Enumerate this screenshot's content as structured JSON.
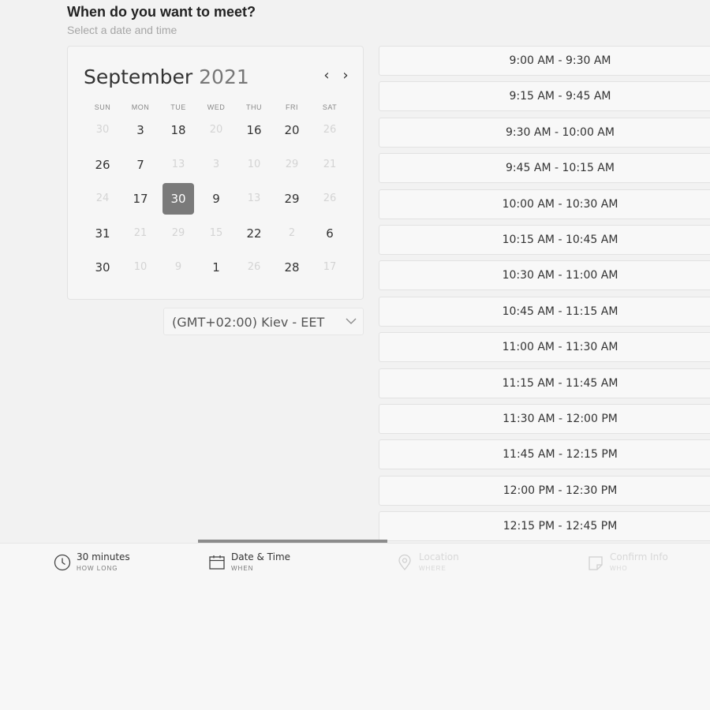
{
  "header": {
    "title": "When do you want to meet?",
    "subtitle": "Select a date and time"
  },
  "calendar": {
    "month": "September",
    "year": "2021",
    "prev_icon": "chevron-left-icon",
    "next_icon": "chevron-right-icon",
    "weekdays": [
      "SUN",
      "MON",
      "TUE",
      "WED",
      "THU",
      "FRI",
      "SAT"
    ],
    "weeks": [
      [
        {
          "d": "30",
          "on": false
        },
        {
          "d": "3",
          "on": true
        },
        {
          "d": "18",
          "on": true
        },
        {
          "d": "20",
          "on": false
        },
        {
          "d": "16",
          "on": true
        },
        {
          "d": "20",
          "on": true
        },
        {
          "d": "26",
          "on": false
        }
      ],
      [
        {
          "d": "26",
          "on": true
        },
        {
          "d": "7",
          "on": true
        },
        {
          "d": "13",
          "on": false
        },
        {
          "d": "3",
          "on": false
        },
        {
          "d": "10",
          "on": false
        },
        {
          "d": "29",
          "on": false
        },
        {
          "d": "21",
          "on": false
        }
      ],
      [
        {
          "d": "24",
          "on": false
        },
        {
          "d": "17",
          "on": true
        },
        {
          "d": "30",
          "on": true,
          "selected": true
        },
        {
          "d": "9",
          "on": true
        },
        {
          "d": "13",
          "on": false
        },
        {
          "d": "29",
          "on": true
        },
        {
          "d": "26",
          "on": false
        }
      ],
      [
        {
          "d": "31",
          "on": true
        },
        {
          "d": "21",
          "on": false
        },
        {
          "d": "29",
          "on": false
        },
        {
          "d": "15",
          "on": false
        },
        {
          "d": "22",
          "on": true
        },
        {
          "d": "2",
          "on": false
        },
        {
          "d": "6",
          "on": true
        }
      ],
      [
        {
          "d": "30",
          "on": true
        },
        {
          "d": "10",
          "on": false
        },
        {
          "d": "9",
          "on": false
        },
        {
          "d": "1",
          "on": true
        },
        {
          "d": "26",
          "on": false
        },
        {
          "d": "28",
          "on": true
        },
        {
          "d": "17",
          "on": false
        }
      ]
    ]
  },
  "timezone": {
    "value": "(GMT+02:00) Kiev - EET",
    "icon": "chevron-down-icon"
  },
  "time_slots": [
    "9:00 AM - 9:30 AM",
    "9:15 AM - 9:45 AM",
    "9:30 AM - 10:00 AM",
    "9:45 AM - 10:15 AM",
    "10:00 AM - 10:30 AM",
    "10:15 AM - 10:45 AM",
    "10:30 AM - 11:00 AM",
    "10:45 AM - 11:15 AM",
    "11:00 AM - 11:30 AM",
    "11:15 AM - 11:45 AM",
    "11:30 AM - 12:00 PM",
    "11:45 AM - 12:15 PM",
    "12:00 PM - 12:30 PM",
    "12:15 PM - 12:45 PM"
  ],
  "steps": [
    {
      "title": "30 minutes",
      "sub": "HOW LONG",
      "icon": "clock-icon",
      "state": "done"
    },
    {
      "title": "Date & Time",
      "sub": "WHEN",
      "icon": "calendar-icon",
      "state": "active"
    },
    {
      "title": "Location",
      "sub": "WHERE",
      "icon": "location-pin-icon",
      "state": "inactive"
    },
    {
      "title": "Confirm Info",
      "sub": "WHO",
      "icon": "note-icon",
      "state": "inactive"
    }
  ]
}
